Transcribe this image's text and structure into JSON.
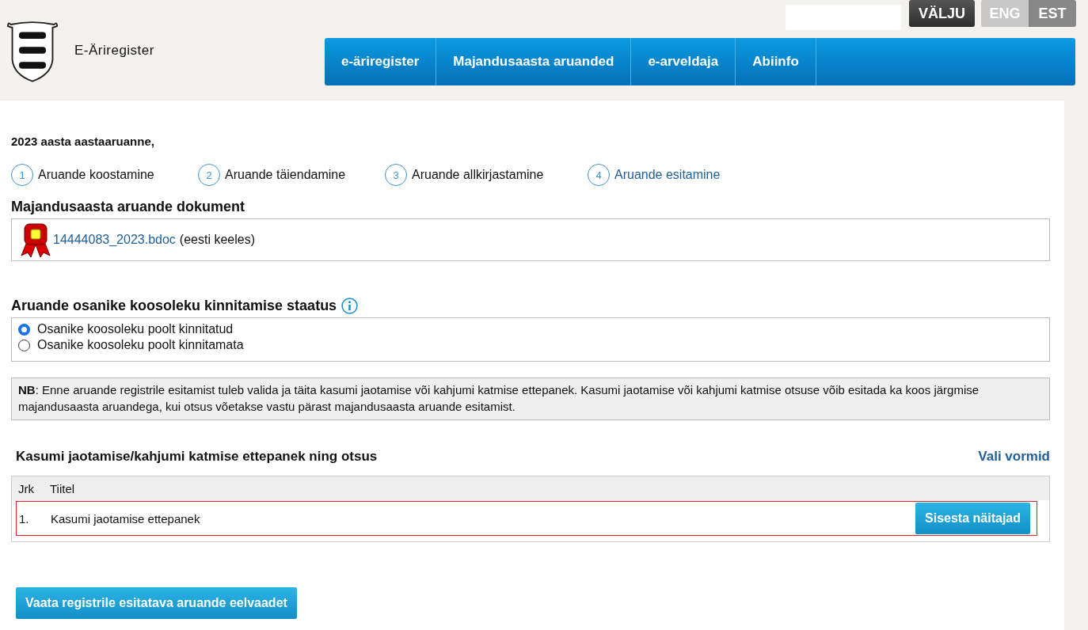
{
  "header": {
    "site_title": "E-Äriregister",
    "logout": "VÄLJU",
    "languages": [
      {
        "label": "ENG",
        "selected": false
      },
      {
        "label": "EST",
        "selected": true
      }
    ],
    "nav": [
      "e-äriregister",
      "Majandusaasta aruanded",
      "e-arveldaja",
      "Abiinfo"
    ]
  },
  "report_title": "2023 aasta aastaaruanne,",
  "steps": [
    {
      "number": "1",
      "label": "Aruande koostamine",
      "selected": false
    },
    {
      "number": "2",
      "label": "Aruande täiendamine",
      "selected": false
    },
    {
      "number": "3",
      "label": "Aruande allkirjastamine",
      "selected": false
    },
    {
      "number": "4",
      "label": "Aruande esitamine",
      "selected": true
    }
  ],
  "document": {
    "heading": "Majandusaasta aruande dokument",
    "file": "14444083_2023.bdoc",
    "language": "(eesti keeles)"
  },
  "approval": {
    "heading": "Aruande osanike koosoleku kinnitamise staatus",
    "options": [
      {
        "label": "Osanike koosoleku poolt kinnitatud",
        "selected": true
      },
      {
        "label": "Osanike koosoleku poolt kinnitamata",
        "selected": false
      }
    ]
  },
  "note": "**NB**: Enne aruande registrile esitamist tuleb valida ja täita kasumi jaotamise või kahjumi katmise ettepanek. Kasumi jaotamise või kahjumi katmise otsuse võib esitada ka koos järgmise majandusaasta aruandega, kui otsus võetakse vastu pärast majandusaasta aruande esitamist.",
  "proposals": {
    "heading": "Kasumi jaotamise/kahjumi katmise ettepanek ning otsus",
    "choose_link": "Vali vormid",
    "columns": [
      "Jrk",
      "Tiitel"
    ],
    "rows": [
      {
        "number": "1.",
        "title": "Kasumi jaotamise ettepanek",
        "action": "Sisesta näitajad",
        "highlighted": true
      }
    ]
  },
  "preview_button": "Vaata registrile esitatava aruande eelvaadet"
}
